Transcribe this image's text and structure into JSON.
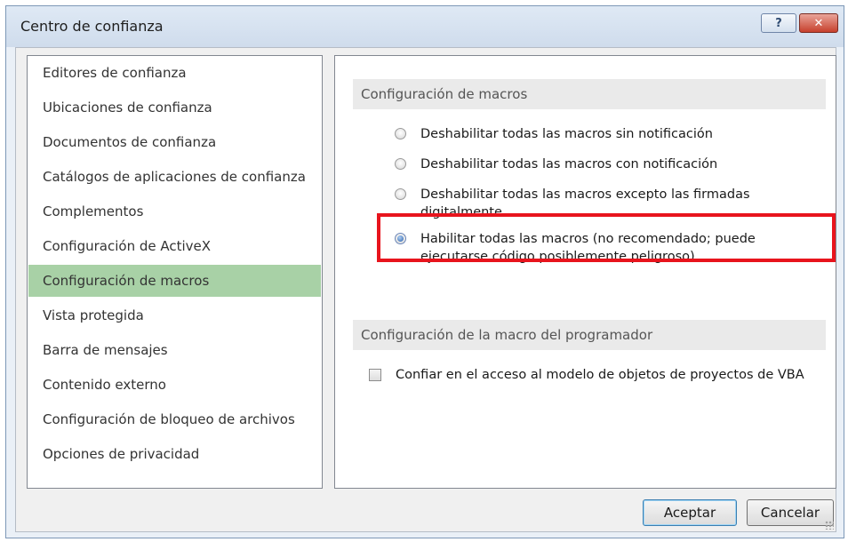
{
  "window": {
    "title": "Centro de confianza",
    "help_label": "?",
    "close_label": "✕"
  },
  "sidebar": {
    "items": [
      {
        "label": "Editores de confianza",
        "selected": false
      },
      {
        "label": "Ubicaciones de confianza",
        "selected": false
      },
      {
        "label": "Documentos de confianza",
        "selected": false
      },
      {
        "label": "Catálogos de aplicaciones de confianza",
        "selected": false
      },
      {
        "label": "Complementos",
        "selected": false
      },
      {
        "label": "Configuración de ActiveX",
        "selected": false
      },
      {
        "label": "Configuración de macros",
        "selected": true
      },
      {
        "label": "Vista protegida",
        "selected": false
      },
      {
        "label": "Barra de mensajes",
        "selected": false
      },
      {
        "label": "Contenido externo",
        "selected": false
      },
      {
        "label": "Configuración de bloqueo de archivos",
        "selected": false
      },
      {
        "label": "Opciones de privacidad",
        "selected": false
      }
    ]
  },
  "macro_settings": {
    "header": "Configuración de macros",
    "options": [
      {
        "label": "Deshabilitar todas las macros sin notificación",
        "checked": false
      },
      {
        "label": "Deshabilitar todas las macros con notificación",
        "checked": false
      },
      {
        "label": "Deshabilitar todas las macros excepto las firmadas digitalmente",
        "checked": false
      },
      {
        "label": "Habilitar todas las macros (no recomendado; puede ejecutarse código posiblemente peligroso)",
        "checked": true
      }
    ]
  },
  "developer_settings": {
    "header": "Configuración de la macro del programador",
    "vba_trust_label": "Confiar en el acceso al modelo de objetos de proyectos de VBA",
    "vba_trust_checked": false
  },
  "buttons": {
    "ok": "Aceptar",
    "cancel": "Cancelar"
  },
  "colors": {
    "selected_item": "#a8d1a6",
    "highlight_border": "#e8141d"
  }
}
